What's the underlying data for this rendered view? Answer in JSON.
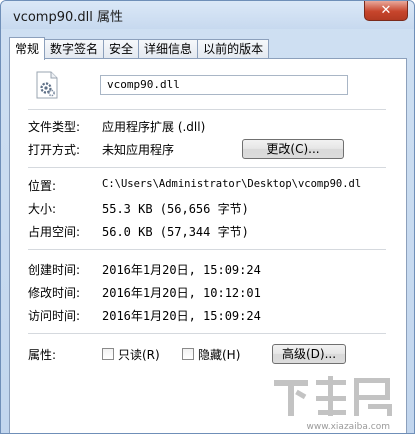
{
  "window": {
    "title": "vcomp90.dll 属性",
    "close_glyph": "✕"
  },
  "tabs": [
    "常规",
    "数字签名",
    "安全",
    "详细信息",
    "以前的版本"
  ],
  "general": {
    "file_name": "vcomp90.dll",
    "file_icon": "dll-gear-file-icon",
    "type_label": "文件类型:",
    "type_value": "应用程序扩展 (.dll)",
    "opens_label": "打开方式:",
    "opens_value": "未知应用程序",
    "change_button": "更改(C)...",
    "location_label": "位置:",
    "location_value": "C:\\Users\\Administrator\\Desktop\\vcomp90.dl",
    "size_label": "大小:",
    "size_value": "55.3 KB (56,656 字节)",
    "disk_size_label": "占用空间:",
    "disk_size_value": "56.0 KB (57,344 字节)",
    "created_label": "创建时间:",
    "created_value": "2016年1月20日, 15:09:24",
    "modified_label": "修改时间:",
    "modified_value": "2016年1月20日, 10:12:01",
    "accessed_label": "访问时间:",
    "accessed_value": "2016年1月20日, 15:09:24",
    "attributes_label": "属性:",
    "readonly_label": "只读(R)",
    "readonly_checked": false,
    "hidden_label": "隐藏(H)",
    "hidden_checked": false,
    "advanced_button": "高级(D)..."
  },
  "watermark": {
    "text": "下载吧",
    "sub": "www.xiazaiba.com"
  }
}
